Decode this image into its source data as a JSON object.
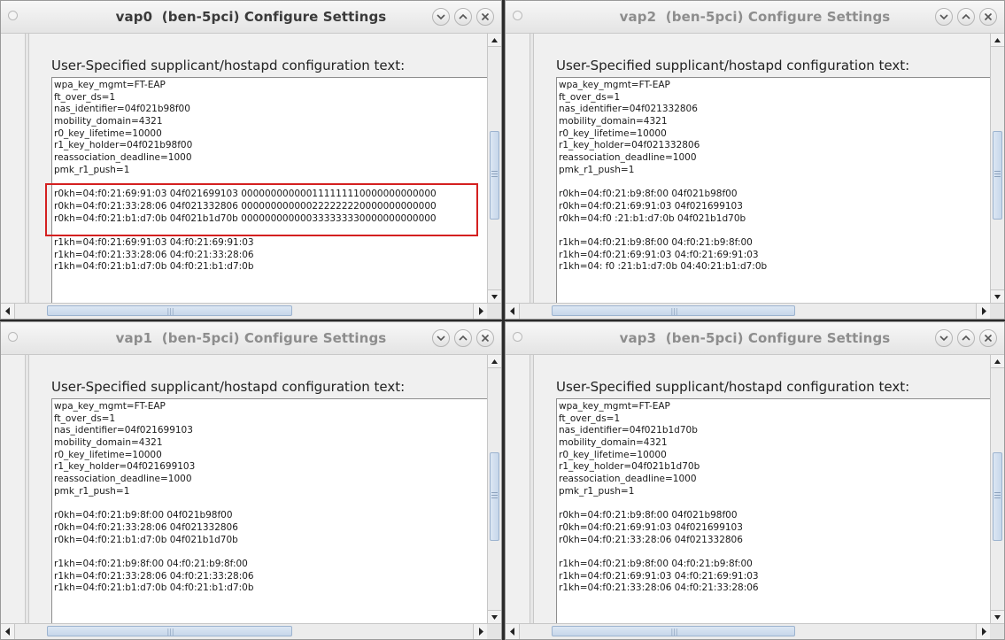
{
  "label": "User-Specified supplicant/hostapd configuration text:",
  "windows": [
    {
      "title": "vap0  (ben-5pci) Configure Settings",
      "lines": [
        "wpa_key_mgmt=FT-EAP",
        "ft_over_ds=1",
        "nas_identifier=04f021b98f00",
        "mobility_domain=4321",
        "r0_key_lifetime=10000",
        "r1_key_holder=04f021b98f00",
        "reassociation_deadline=1000",
        "pmk_r1_push=1",
        "",
        "r0kh=04:f0:21:69:91:03 04f021699103 000000000000111111110000000000000",
        "r0kh=04:f0:21:33:28:06 04f021332806 000000000000222222220000000000000",
        "r0kh=04:f0:21:b1:d7:0b 04f021b1d70b 000000000000333333330000000000000",
        "",
        "r1kh=04:f0:21:69:91:03 04:f0:21:69:91:03",
        "r1kh=04:f0:21:33:28:06 04:f0:21:33:28:06",
        "r1kh=04:f0:21:b1:d7:0b 04:f0:21:b1:d7:0b"
      ]
    },
    {
      "title": "vap2  (ben-5pci) Configure Settings",
      "lines": [
        "wpa_key_mgmt=FT-EAP",
        "ft_over_ds=1",
        "nas_identifier=04f021332806",
        "mobility_domain=4321",
        "r0_key_lifetime=10000",
        "r1_key_holder=04f021332806",
        "reassociation_deadline=1000",
        "pmk_r1_push=1",
        "",
        "r0kh=04:f0:21:b9:8f:00 04f021b98f00",
        "r0kh=04:f0:21:69:91:03 04f021699103",
        "r0kh=04:f0 :21:b1:d7:0b 04f021b1d70b",
        "",
        "r1kh=04:f0:21:b9:8f:00 04:f0:21:b9:8f:00",
        "r1kh=04:f0:21:69:91:03 04:f0:21:69:91:03",
        "r1kh=04: f0 :21:b1:d7:0b 04:40:21:b1:d7:0b"
      ]
    },
    {
      "title": "vap1  (ben-5pci) Configure Settings",
      "lines": [
        "wpa_key_mgmt=FT-EAP",
        "ft_over_ds=1",
        "nas_identifier=04f021699103",
        "mobility_domain=4321",
        "r0_key_lifetime=10000",
        "r1_key_holder=04f021699103",
        "reassociation_deadline=1000",
        "pmk_r1_push=1",
        "",
        "r0kh=04:f0:21:b9:8f:00 04f021b98f00",
        "r0kh=04:f0:21:33:28:06 04f021332806",
        "r0kh=04:f0:21:b1:d7:0b 04f021b1d70b",
        "",
        "r1kh=04:f0:21:b9:8f:00 04:f0:21:b9:8f:00",
        "r1kh=04:f0:21:33:28:06 04:f0:21:33:28:06",
        "r1kh=04:f0:21:b1:d7:0b 04:f0:21:b1:d7:0b"
      ]
    },
    {
      "title": "vap3  (ben-5pci) Configure Settings",
      "lines": [
        "wpa_key_mgmt=FT-EAP",
        "ft_over_ds=1",
        "nas_identifier=04f021b1d70b",
        "mobility_domain=4321",
        "r0_key_lifetime=10000",
        "r1_key_holder=04f021b1d70b",
        "reassociation_deadline=1000",
        "pmk_r1_push=1",
        "",
        "r0kh=04:f0:21:b9:8f:00 04f021b98f00",
        "r0kh=04:f0:21:69:91:03 04f021699103",
        "r0kh=04:f0:21:33:28:06 04f021332806",
        "",
        "r1kh=04:f0:21:b9:8f:00 04:f0:21:b9:8f:00",
        "r1kh=04:f0:21:69:91:03 04:f0:21:69:91:03",
        "r1kh=04:f0:21:33:28:06 04:f0:21:33:28:06"
      ]
    }
  ],
  "highlight_color": "#d42020",
  "icons": [
    "window-menu-icon",
    "minimize-icon",
    "maximize-icon",
    "close-icon",
    "scroll-up-arrow-icon",
    "scroll-down-arrow-icon",
    "scroll-left-arrow-icon",
    "scroll-right-arrow-icon"
  ]
}
